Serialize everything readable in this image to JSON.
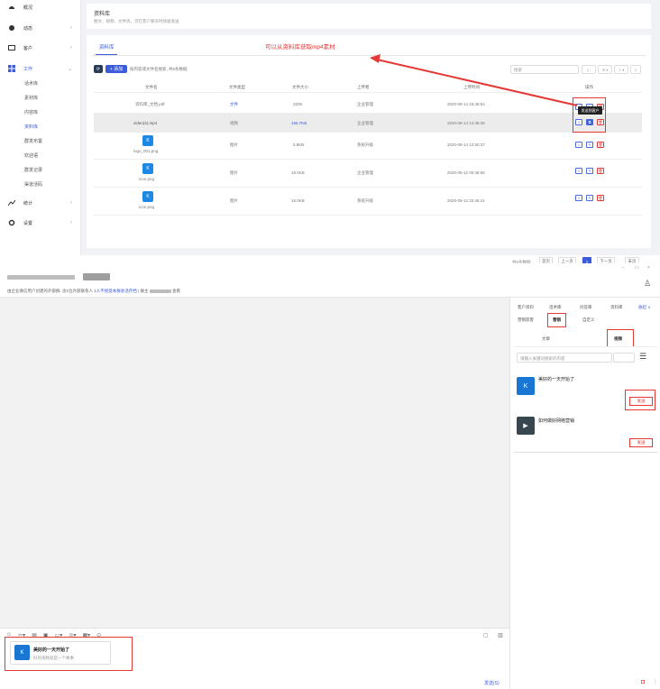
{
  "sidebar": {
    "items": [
      {
        "label": "概况",
        "icon": "dashboard-icon"
      },
      {
        "label": "动态",
        "icon": "activity-icon"
      },
      {
        "label": "客户",
        "icon": "customer-icon"
      },
      {
        "label": "工作",
        "icon": "work-icon"
      },
      {
        "label": "统计",
        "icon": "chart-icon"
      },
      {
        "label": "设置",
        "icon": "gear-icon"
      }
    ],
    "work_sub": [
      "话术库",
      "素材库",
      "内容库",
      "资料库",
      "群发布置",
      "欢迎语",
      "群发记录",
      "渠道活码"
    ],
    "active_sub": "资料库"
  },
  "header": {
    "title": "资料库",
    "subtitle": "图文、视频、文件等，可在客户聊天时快速发送"
  },
  "main": {
    "tab": "资料库",
    "annotation": "可以从资料库获取mp4素材",
    "add_button": "+ 添加",
    "filter_label": "按内容或文件名搜索, 共5条数据",
    "search_placeholder": "搜索",
    "columns": [
      "文件名",
      "文件类型",
      "文件大小",
      "上传者",
      "上传时间",
      "操作"
    ],
    "rows": [
      {
        "name": "资料库_文档.pdf",
        "type": "文件",
        "size": "320K",
        "uploader": "企业管理",
        "time": "2020-08-14 15:48:54"
      },
      {
        "name": "video(4).mp4",
        "type": "视频",
        "size": "166.7KB",
        "uploader": "企业管理",
        "time": "2020-08-14 14:38:36"
      },
      {
        "name": "logo_001.png",
        "type": "图片",
        "size": "5.8KB",
        "uploader": "系统升级",
        "time": "2020-08-14 12:50:37"
      },
      {
        "name": "icon.png",
        "type": "图片",
        "size": "18.0KB",
        "uploader": "企业管理",
        "time": "2020-08-12 00:48:56"
      },
      {
        "name": "icon.png",
        "type": "图片",
        "size": "16.0KB",
        "uploader": "系统升级",
        "time": "2020-08-12 22:46:41"
      }
    ],
    "tooltip": "发送到客户",
    "pagination": {
      "total": "共5条数据",
      "first": "首页",
      "prev": "上一页",
      "page": "1",
      "next": "下一页",
      "last": "末页"
    }
  },
  "chat": {
    "window_controls": [
      "−",
      "▭",
      "×"
    ],
    "notice": "由企业微信用户创建的外部群, 含1位外部联系人",
    "notice_link": "1人不接受本群会话存档",
    "notice_tail": "| 群主",
    "notice_tail2": "查看",
    "right_tabs": [
      "客户资料",
      "话术库",
      "问答库",
      "资料库",
      "收起 ∧"
    ],
    "right_tabs2": [
      "营销获客",
      "营销",
      "自定义"
    ],
    "sub_tabs": [
      "文章",
      "视频"
    ],
    "search_placeholder": "请输入关键词搜索的内容",
    "items": [
      {
        "title": "美好的一天开始了",
        "send": "发送"
      },
      {
        "title": "如何做好网络营销",
        "send": "发送"
      }
    ],
    "card_title": "美好的一天开始了",
    "card_desc": "好的视频就是一个故事",
    "send_label": "发送(S)"
  },
  "colors": {
    "accent": "#3b5bdb",
    "highlight": "#e53935",
    "sidebar_bg": "#ffffff"
  }
}
